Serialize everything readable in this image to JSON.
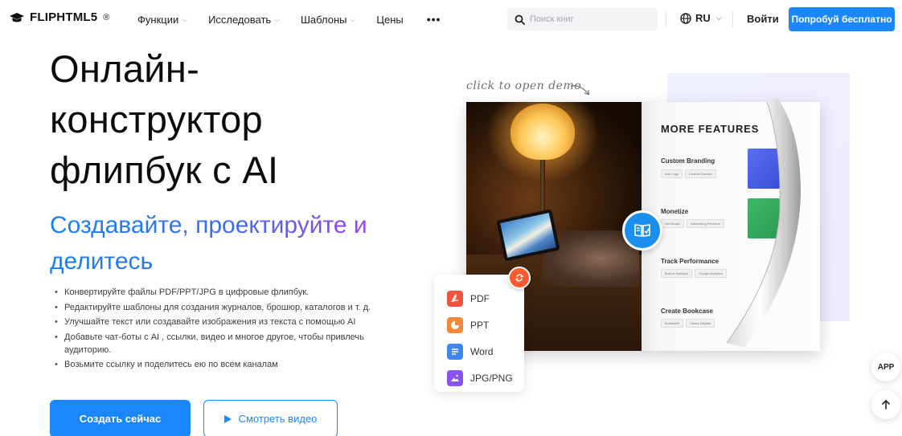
{
  "header": {
    "logo_text": "FLIPHTML5",
    "logo_mark": "®",
    "nav": [
      {
        "label": "Функции",
        "has_dropdown": true
      },
      {
        "label": "Исследовать",
        "has_dropdown": true
      },
      {
        "label": "Шаблоны",
        "has_dropdown": true
      },
      {
        "label": "Цены",
        "has_dropdown": false
      }
    ],
    "more_label": "•••",
    "search_placeholder": "Поиск книг",
    "language": "RU",
    "login_label": "Войти",
    "try_label": "Попробуй бесплатно"
  },
  "hero": {
    "title_lines": [
      "Онлайн-",
      "конструктор",
      "флипбук с AI"
    ],
    "subtitle_lines": [
      "Создавайте, проектируйте и",
      "делитесь"
    ],
    "features": [
      "Конвертируйте файлы PDF/PPT/JPG в цифровые флипбук.",
      "Редактируйте шаблоны для создания журналов, брошюр, каталогов и т. д.",
      "Улучшайте текст или создавайте изображения из текста с помощью AI",
      "Добавьте чат-боты с AI , ссылки, видео и многое другое, чтобы привлечь аудиторию.",
      "Возьмите ссылку и поделитесь ею по всем каналам"
    ],
    "create_label": "Создать сейчас",
    "video_label": "Смотреть видео"
  },
  "demo": {
    "hint": "click to open demo",
    "page_title": "MORE FEATURES",
    "sections": [
      {
        "title": "Custom Branding",
        "tags": [
          "Add Logo",
          "Custom Domain"
        ]
      },
      {
        "title": "Monetize",
        "tags": [
          "Sell Books",
          "Advertising Revenue"
        ]
      },
      {
        "title": "Track Performance",
        "tags": [
          "Built-in Statistics",
          "Google Analytics"
        ]
      },
      {
        "title": "Create Bookcase",
        "tags": [
          "Bookshelf",
          "Library Display"
        ]
      }
    ],
    "formats": [
      {
        "label": "PDF",
        "color": "#f0533f",
        "icon": "pdf-icon"
      },
      {
        "label": "PPT",
        "color": "#f5893a",
        "icon": "ppt-icon"
      },
      {
        "label": "Word",
        "color": "#3e86f5",
        "icon": "word-icon"
      },
      {
        "label": "JPG/PNG",
        "color": "#8a52f0",
        "icon": "image-icon"
      }
    ]
  },
  "floating": {
    "app_label": "APP"
  },
  "colors": {
    "primary": "#1a86ff",
    "gradient_start": "#1480f5",
    "gradient_end": "#b04be0"
  }
}
